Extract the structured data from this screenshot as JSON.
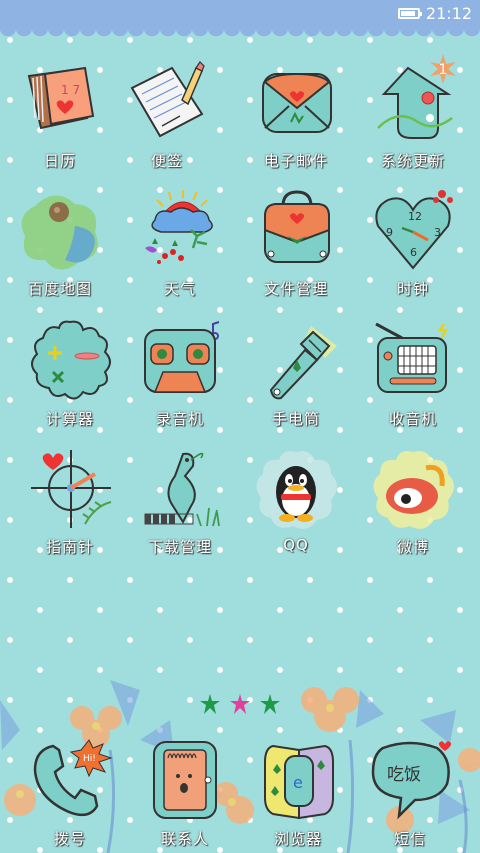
{
  "status_bar": {
    "time": "21:12",
    "battery_level": 0.85
  },
  "apps": [
    {
      "label": "日历",
      "icon": "calendar-icon"
    },
    {
      "label": "便签",
      "icon": "notepad-icon"
    },
    {
      "label": "电子邮件",
      "icon": "envelope-icon"
    },
    {
      "label": "系统更新",
      "icon": "system-update-icon",
      "badge": "1"
    },
    {
      "label": "百度地图",
      "icon": "map-icon"
    },
    {
      "label": "天气",
      "icon": "weather-icon"
    },
    {
      "label": "文件管理",
      "icon": "file-bag-icon"
    },
    {
      "label": "时钟",
      "icon": "clock-icon"
    },
    {
      "label": "计算器",
      "icon": "calculator-icon"
    },
    {
      "label": "录音机",
      "icon": "recorder-icon"
    },
    {
      "label": "手电筒",
      "icon": "flashlight-icon"
    },
    {
      "label": "收音机",
      "icon": "radio-icon"
    },
    {
      "label": "指南针",
      "icon": "compass-icon"
    },
    {
      "label": "下载管理",
      "icon": "download-bird-icon"
    },
    {
      "label": "QQ",
      "icon": "qq-penguin-icon"
    },
    {
      "label": "微博",
      "icon": "weibo-icon"
    }
  ],
  "page_indicator": {
    "pages": 3,
    "current": 1
  },
  "dock": [
    {
      "label": "拨号",
      "icon": "phone-icon"
    },
    {
      "label": "联系人",
      "icon": "contacts-icon"
    },
    {
      "label": "浏览器",
      "icon": "browser-icon"
    },
    {
      "label": "短信",
      "icon": "sms-icon",
      "bubble_text": "吃饭"
    }
  ],
  "colors": {
    "background": "#9fdedd",
    "status_bar": "#8fb3e2",
    "icon_teal": "#7ecfc7",
    "icon_orange": "#ee8454",
    "indicator_active": "#e0409c",
    "indicator_inactive": "#1f9a4a"
  }
}
